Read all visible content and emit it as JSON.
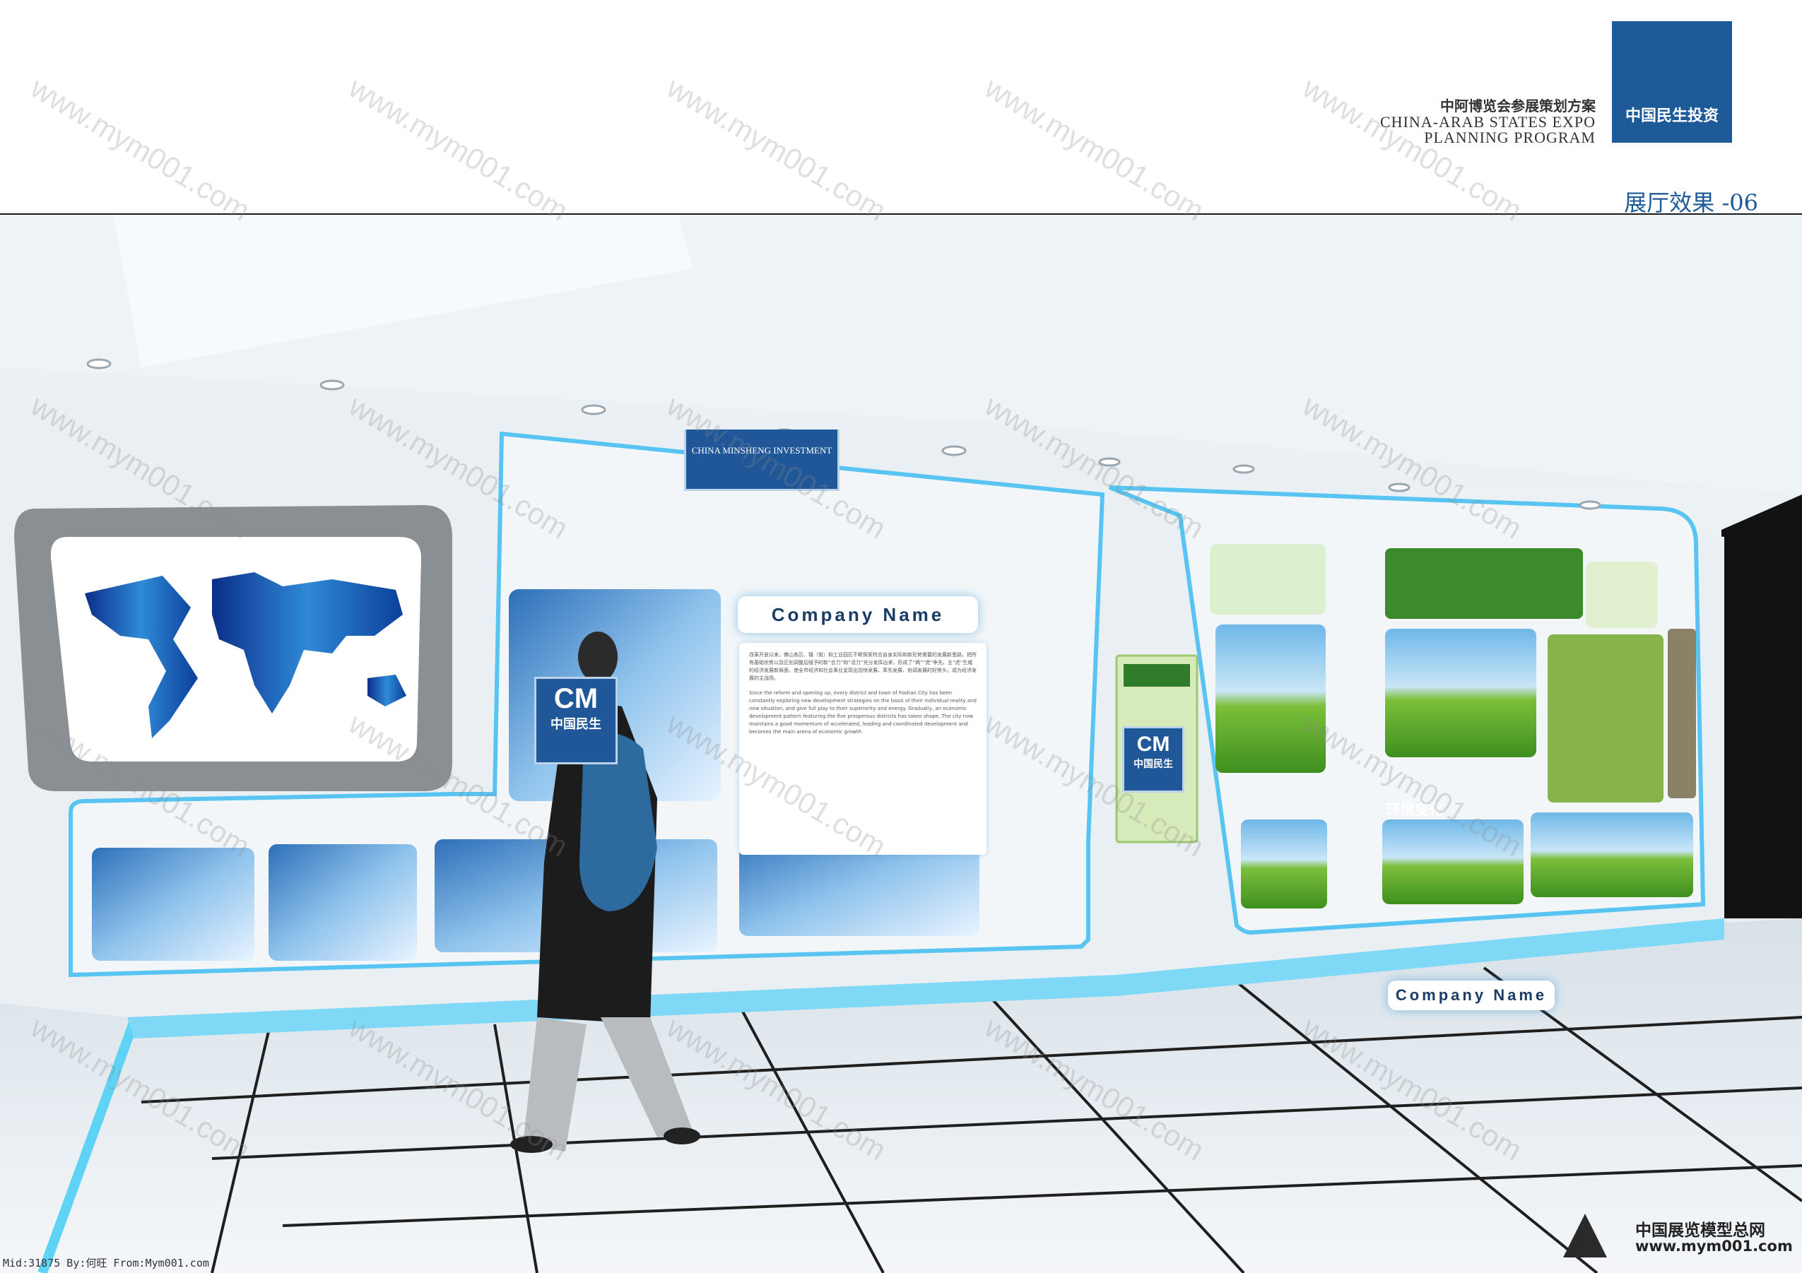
{
  "header": {
    "title_cn": "中阿博览会参展策划方案",
    "title_en_line1": "CHINA-ARAB STATES EXPO",
    "title_en_line2": "PLANNING PROGRAM",
    "brand": "中国民生投资",
    "page_label": "展厅效果 -06"
  },
  "scene": {
    "top_sign": "CHINA MINSHENG INVESTMENT",
    "cm_sign": {
      "mark": "CM",
      "name": "中国民生"
    },
    "company_name": "Company Name",
    "text_panel": {
      "cn": "改革开放以来，佛山各区、镇（街）和工业园区不断探索符合自身实际和新形势需要的发展新思路，把所有基础优势以及区划调整后赋予的新“合力”和“活力”充分发挥出来，形成了“两”“虎”争先、五“虎”生威的经济发展新局面，使全市经济和社会事业呈现出加快发展、率先发展、协调发展的好势头，成为经济发展的主战场。",
      "en": "Since the reform and opening up, every district and town of Foshan City has been constantly exploring new development strategies on the basis of their individual reality and new situation, and give full play to their superiority and energy. Gradually, an economic development pattern featuring the five prosperous districts has taken shape. The city now maintains a good momentum of accelerated, leading and coordinated development and becomes the main arena of economic growth."
    },
    "env_banner": "环境变化",
    "company_name_2": "Company Name"
  },
  "footer": {
    "watermark": "Mid:31875 By:何旺 From:Mym001.com",
    "site_name": "中国展览模型总网",
    "site_url": "www.mym001.com"
  },
  "watermark_text": "www.mym001.com"
}
